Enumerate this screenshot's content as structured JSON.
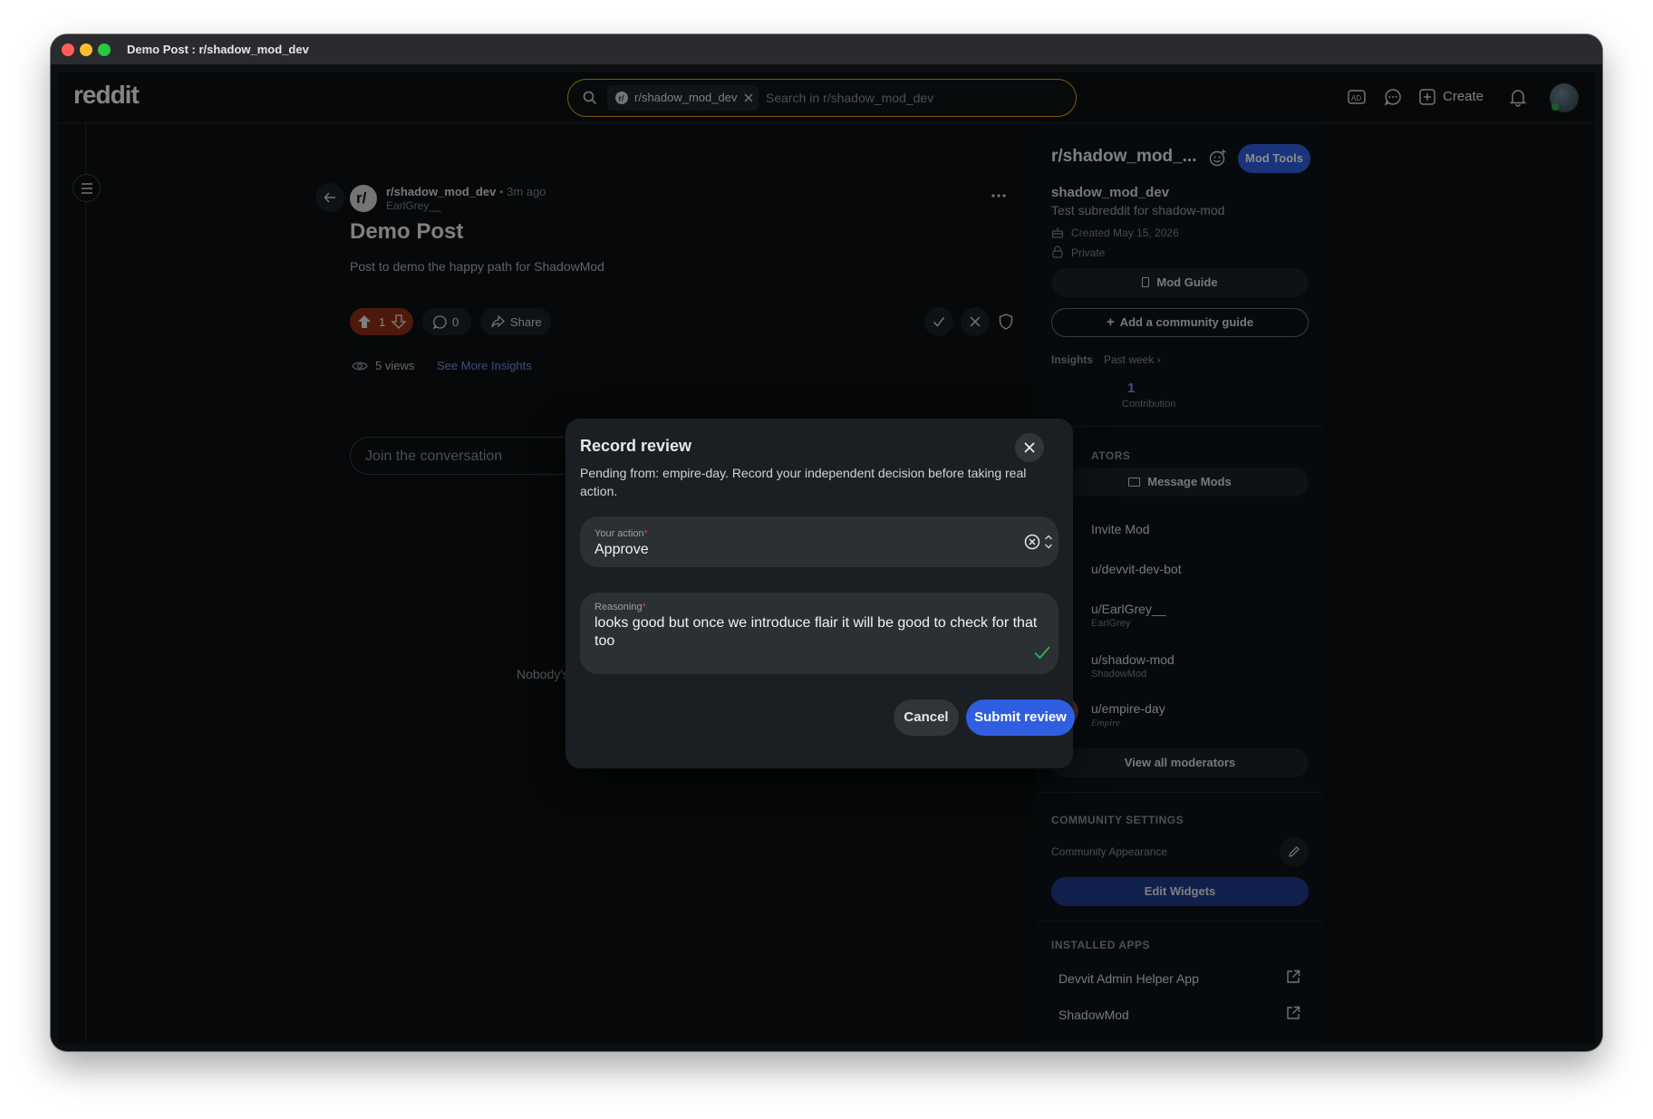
{
  "window": {
    "title": "Demo Post : r/shadow_mod_dev"
  },
  "header": {
    "logo": "reddit",
    "search_chip": "r/shadow_mod_dev",
    "search_placeholder": "Search in r/shadow_mod_dev",
    "create_label": "Create"
  },
  "post": {
    "subreddit": "r/shadow_mod_dev",
    "time": "• 3m ago",
    "author": "EarlGrey__",
    "title": "Demo Post",
    "body": "Post to demo the happy path for ShadowMod",
    "votes": "1",
    "comments": "0",
    "share": "Share",
    "views": "5 views",
    "insights_link": "See More Insights",
    "join_placeholder": "Join the conversation",
    "empty_text": "Nobody's"
  },
  "sidebar": {
    "name": "r/shadow_mod_...",
    "mod_tools": "Mod Tools",
    "display_name": "shadow_mod_dev",
    "description": "Test subreddit for shadow-mod",
    "created": "Created May 15, 2026",
    "privacy": "Private",
    "mod_guide": "Mod Guide",
    "add_guide": "Add a community guide",
    "insights_label": "Insights",
    "insights_period": "Past week ›",
    "contributions_value": "1",
    "contributions_label": "Contribution",
    "moderators_header": "ATORS",
    "message_mods": "Message Mods",
    "invite_mod": "Invite Mod",
    "moderators": [
      {
        "name": "u/devvit-dev-bot",
        "flair": ""
      },
      {
        "name": "u/EarlGrey__",
        "flair": "EarlGrey"
      },
      {
        "name": "u/shadow-mod",
        "flair": "ShadowMod"
      },
      {
        "name": "u/empire-day",
        "flair": "Empire"
      }
    ],
    "view_all_mods": "View all moderators",
    "community_settings_header": "COMMUNITY SETTINGS",
    "community_appearance": "Community Appearance",
    "edit_widgets": "Edit Widgets",
    "installed_apps_header": "INSTALLED APPS",
    "apps": [
      "Devvit Admin Helper App",
      "ShadowMod"
    ]
  },
  "modal": {
    "title": "Record review",
    "description": "Pending from: empire-day. Record your independent decision before taking real action.",
    "action_label": "Your action",
    "action_value": "Approve",
    "reasoning_label": "Reasoning",
    "reasoning_value": "looks good but once we introduce flair it will be good to check for that too",
    "cancel": "Cancel",
    "submit": "Submit review",
    "required_mark": "*"
  },
  "colors": {
    "accent_blue": "#2f5fe0",
    "upvote_orange": "#8f2f19",
    "search_border": "#e3a416",
    "valid_green": "#2db34a"
  }
}
